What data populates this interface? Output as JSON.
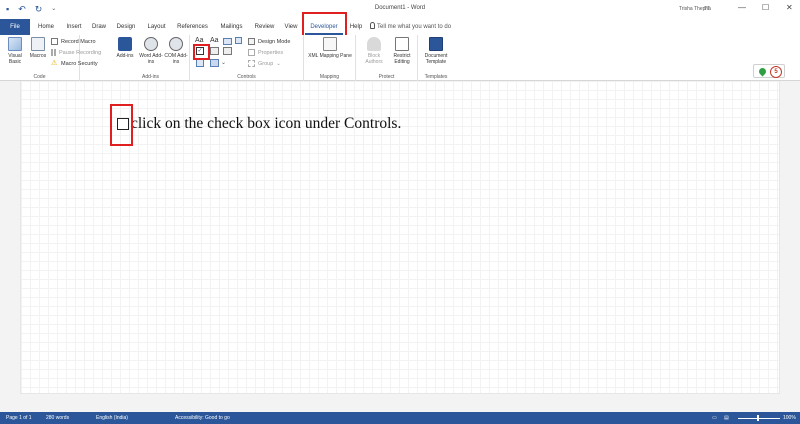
{
  "titlebar": {
    "doc_title": "Document1 - Word",
    "user_name": "Trisha Thepna",
    "user_initials": "TT",
    "minimize": "—",
    "restore": "☐",
    "close": "✕"
  },
  "tabs": [
    "File",
    "Home",
    "Insert",
    "Draw",
    "Design",
    "Layout",
    "References",
    "Mailings",
    "Review",
    "View",
    "Developer",
    "Help"
  ],
  "tell_me": "Tell me what you want to do",
  "ribbon": {
    "code": {
      "label": "Code",
      "visual_basic": "Visual Basic",
      "macros": "Macros",
      "record_macro": "Record Macro",
      "pause_recording": "Pause Recording",
      "macro_security": "Macro Security"
    },
    "addins": {
      "label": "Add-ins",
      "addins": "Add-ins",
      "word_addins": "Word Add-ins",
      "com_addins": "COM Add-ins"
    },
    "controls": {
      "label": "Controls",
      "design_mode": "Design Mode",
      "properties": "Properties",
      "group": "Group"
    },
    "mapping": {
      "label": "Mapping",
      "xml_mapping_pane": "XML Mapping Pane"
    },
    "protect": {
      "label": "Protect",
      "block_authors": "Block Authors",
      "restrict_editing": "Restrict Editing"
    },
    "templates": {
      "label": "Templates",
      "document_template": "Document Template"
    }
  },
  "badge_count": "5",
  "document": {
    "text": "click on the check box icon under Controls."
  },
  "statusbar": {
    "page": "Page 1 of 1",
    "words": "280 words",
    "language": "English (India)",
    "accessibility": "Accessibility: Good to go",
    "zoom": "100%"
  },
  "colors": {
    "brand": "#2b579a",
    "highlight": "#e02020"
  }
}
